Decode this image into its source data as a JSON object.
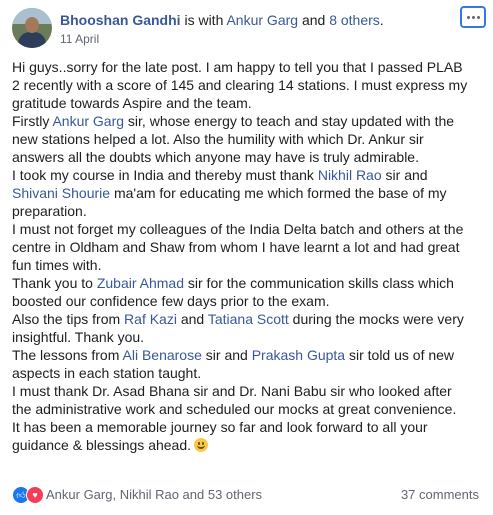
{
  "header": {
    "author": "Bhooshan Gandhi",
    "is_with": " is with ",
    "tagged": "Ankur Garg",
    "and": " and ",
    "others": "8 others",
    "period": ".",
    "date": "11 April"
  },
  "body": {
    "l1": "Hi guys..sorry for the late post. I am happy to tell you that I passed PLAB",
    "l2": "2 recently with a score of 145 and clearing 14 stations. I must express my",
    "l3": "gratitude towards Aspire and the team.",
    "l4_a": "Firstly ",
    "l4_link": "Ankur Garg",
    "l4_b": " sir, whose energy to teach and stay updated with the",
    "l5": "new stations helped a lot. Also the humility with which Dr. Ankur sir",
    "l6": "answers all the doubts which anyone may have is truly admirable.",
    "l7_a": "I took my course in India and thereby must thank ",
    "l7_link": "Nikhil Rao",
    "l7_b": " sir and",
    "l8_link": "Shivani Shourie",
    "l8_b": " ma'am for educating me which formed the base of my",
    "l9": "preparation.",
    "l10": "I must not forget my colleagues of the India Delta batch and others at the",
    "l11": "centre in Oldham and Shaw from whom I have learnt a lot and had great",
    "l12": "fun times with.",
    "l13_a": "Thank you to ",
    "l13_link": "Zubair Ahmad",
    "l13_b": " sir for the communication skills class which",
    "l14": "boosted our confidence few days prior to the exam.",
    "l15_a": "Also the tips from ",
    "l15_link1": "Raf Kazi",
    "l15_and": " and ",
    "l15_link2": "Tatiana Scott",
    "l15_b": " during the mocks were very",
    "l16": "insightful. Thank you.",
    "l17_a": "The lessons from ",
    "l17_link1": "Ali Benarose",
    "l17_mid": " sir and ",
    "l17_link2": "Prakash Gupta",
    "l17_b": " sir told us of new",
    "l18": "aspects in each station taught.",
    "l19": "I must thank Dr. Asad Bhana sir and Dr. Nani Babu sir who looked after",
    "l20": "the administrative work and scheduled our mocks at great convenience.",
    "l21": "It has been a memorable journey so far and look forward to all your",
    "l22": "guidance & blessings ahead."
  },
  "footer": {
    "reactors": "Ankur Garg, Nikhil Rao and 53 others",
    "comments": "37 comments"
  },
  "icons": {
    "like": "like-reaction-icon",
    "love": "love-reaction-icon",
    "more": "more-options-icon"
  },
  "colors": {
    "link": "#385898",
    "text": "#1c1e21",
    "muted": "#606770",
    "like": "#1877f2",
    "love": "#f33e58"
  }
}
